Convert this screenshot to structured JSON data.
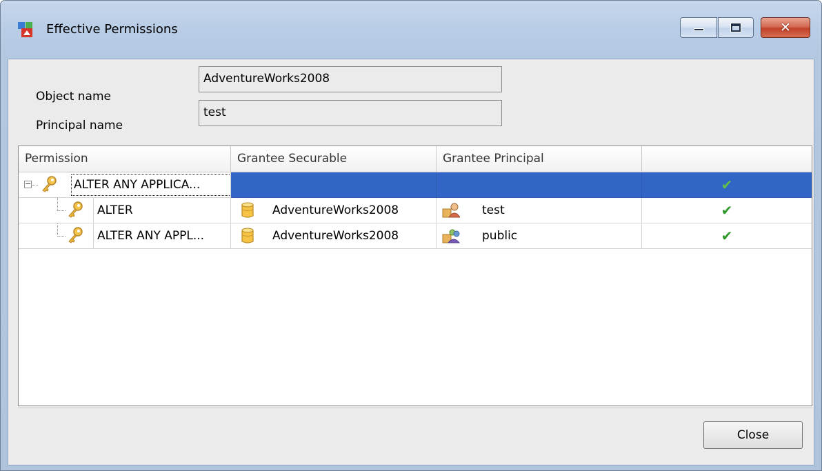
{
  "window": {
    "title": "Effective Permissions",
    "controls": {
      "minimize": "minimize",
      "maximize": "maximize",
      "close": "close"
    }
  },
  "form": {
    "object_label": "Object name",
    "object_value": "AdventureWorks2008",
    "principal_label": "Principal name",
    "principal_value": "test"
  },
  "grid": {
    "columns": [
      "Permission",
      "Grantee Securable",
      "Grantee Principal",
      ""
    ],
    "rows": [
      {
        "permission": "ALTER ANY APPLICA...",
        "securable": "",
        "principal": "",
        "granted": "✔",
        "selected": true,
        "level": 0
      },
      {
        "permission": "ALTER",
        "securable": "AdventureWorks2008",
        "principal": "test",
        "granted": "✔",
        "selected": false,
        "level": 1
      },
      {
        "permission": "ALTER ANY APPL...",
        "securable": "AdventureWorks2008",
        "principal": "public",
        "granted": "✔",
        "selected": false,
        "level": 1
      }
    ]
  },
  "footer": {
    "close_label": "Close"
  },
  "colors": {
    "selection": "#3166c6",
    "check": "#2e9a2a",
    "close_button": "#c2422a"
  },
  "icons": [
    "app-permissions-icon",
    "key-icon",
    "database-icon",
    "user-icon",
    "group-icon",
    "checkmark-icon",
    "tree-collapse-icon"
  ]
}
